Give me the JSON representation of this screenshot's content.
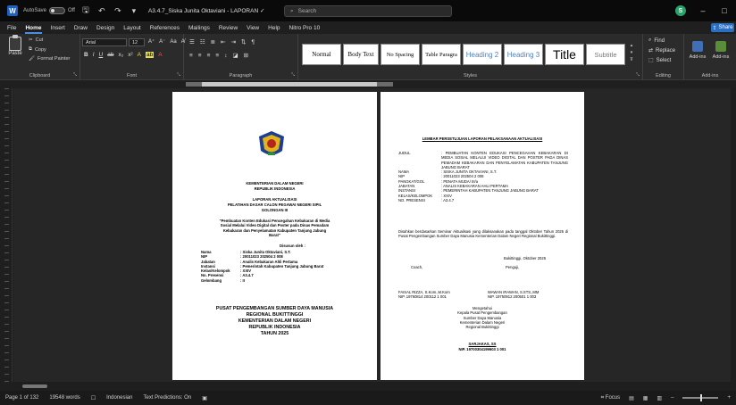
{
  "window": {
    "autosave_label": "AutoSave",
    "toggle_state": "Off",
    "doc_title": "A3.4.7_Siska Junita Oktaviani - LAPORAN ✓",
    "search_placeholder": "Search",
    "avatar_initial": "S",
    "minimize": "–",
    "restore": "□"
  },
  "menu": {
    "items": [
      "File",
      "Home",
      "Insert",
      "Draw",
      "Design",
      "Layout",
      "References",
      "Mailings",
      "Review",
      "View",
      "Help",
      "Nitro Pro 10"
    ],
    "active": "Home",
    "share": "Share"
  },
  "ribbon": {
    "clipboard": {
      "paste": "Paste",
      "cut": "Cut",
      "copy": "Copy",
      "format_painter": "Format Painter",
      "label": "Clipboard"
    },
    "font": {
      "name": "Arial",
      "size": "12",
      "label": "Font"
    },
    "paragraph": {
      "label": "Paragraph"
    },
    "styles": {
      "label": "Styles",
      "items": [
        "Normal",
        "Body Text",
        "No Spacing",
        "Table Paragra",
        "Heading 2",
        "Heading 3",
        "Title",
        "Subtitle"
      ]
    },
    "editing": {
      "find": "Find",
      "replace": "Replace",
      "select": "Select",
      "label": "Editing"
    },
    "addins": {
      "a1": "Add-ins",
      "a2": "Add-ins",
      "label": "Add-ins"
    }
  },
  "page1": {
    "org1": "KEMENTERIAN DALAM NEGERI",
    "org2": "REPUBLIK INDONESIA",
    "rpt1": "LAPORAN AKTUALISASI",
    "rpt2": "PELATIHAN DASAR CALON PEGAWAI NEGERI SIPIL",
    "rpt3": "GOLONGAN III",
    "topic": "\"Pembuatan Konten Edukasi Pencegahan Kebakaran di Media Sosial Melalui Video Digital dan Poster pada Dinas Pemadam Kebakaran dan Penyelamatan Kabupaten Tanjung Jabung Barat\"",
    "by": "Disusun oleh :",
    "fields": [
      {
        "k": "Nama",
        "v": ": Siska Junita Oktaviani, S.T."
      },
      {
        "k": "NIP",
        "v": ": 20011023 202504 2 008"
      },
      {
        "k": "Jabatan",
        "v": ": Analis Kebakaran Ahli Pertama"
      },
      {
        "k": "Instansi",
        "v": ": Pemerintah Kabupaten Tanjung Jabung Barat"
      },
      {
        "k": "Kelas/Kelompok",
        "v": ": XXIV"
      },
      {
        "k": "No. Presensi",
        "v": ": A3.4.7"
      },
      {
        "k": "Gelombang",
        "v": ": II"
      }
    ],
    "footer": [
      "PUSAT PENGEMBANGAN SUMBER DAYA MANUSIA",
      "REGIONAL BUKITTINGGI",
      "KEMENTERIAN DALAM NEGERI",
      "REPUBLIK INDONESIA",
      "TAHUN 2025"
    ]
  },
  "page2": {
    "heading": "LEMBAR PERSETUJUAN LAPORAN PELAKSANAAN AKTUALISASI",
    "judul_k": "JUDUL",
    "judul_v": ": PEMBUATAN KONTEN EDUKASI PENCEGAHAN KEBAKARAN DI MEDIA SOSIAL MELALUI VIDEO DIGITAL DAN POSTER PADA DINAS PEMADAM KEBAKARAN DAN PENYELAMATAN KABUPATEN TANJUNG JABUNG BARAT",
    "fields": [
      {
        "k": "NAMA",
        "v": ": SISKA JUNITA OKTAVIANI, S.T."
      },
      {
        "k": "NIP",
        "v": ": 20011023 202504 2 008"
      },
      {
        "k": "PANGKAT/GOL",
        "v": ": PENATA MUDA/ III/a"
      },
      {
        "k": "JABATAN",
        "v": ": ANALIS KEBAKARAN AHLI PERTAMA"
      },
      {
        "k": "INSTANSI",
        "v": ": PEMERINTAH KABUPATEN TANJUNG JABUNG BARAT"
      },
      {
        "k": "KELAS/KELOMPOK",
        "v": ": XXIV"
      },
      {
        "k": "NO. PRESENSI",
        "v": ": A3.4.7"
      }
    ],
    "body": "Disahkan berdasarkan Seminar Aktualisasi yang dilaksanakan pada tanggal Oktober Tahun 2025 di Pusat Pengembangan Sumber Daya Manusia Kementerian Dalam Negeri Regional Bukittinggi.",
    "place_date": "Bukittinggi,     Oktober 2025",
    "coach": "Coach,",
    "mentor": "Penguji,",
    "sig1_name": "FAISAL RIZZA, S.Kom.,M.Kom",
    "sig1_nip": "NIP. 19760814 200112 1 001",
    "sig2_name": "WAWAN IRAWAN, S.STS.,MM",
    "sig2_nip": "NIP. 19750912 200501 1 003",
    "approve": [
      "Mengetahui",
      "Kepala Pusat Pengembangan",
      "Sumber Daya Manusia",
      "Kementerian Dalam Negeri",
      "Regional Bukittinggi"
    ],
    "head_name": "SARJAKAS, SS",
    "head_nip": "NIP. 19700304199603 1 001"
  },
  "status": {
    "page": "Page 1 of 132",
    "words": "19548 words",
    "language": "Indonesian",
    "predictions": "Text Predictions: On",
    "focus": "Focus"
  }
}
